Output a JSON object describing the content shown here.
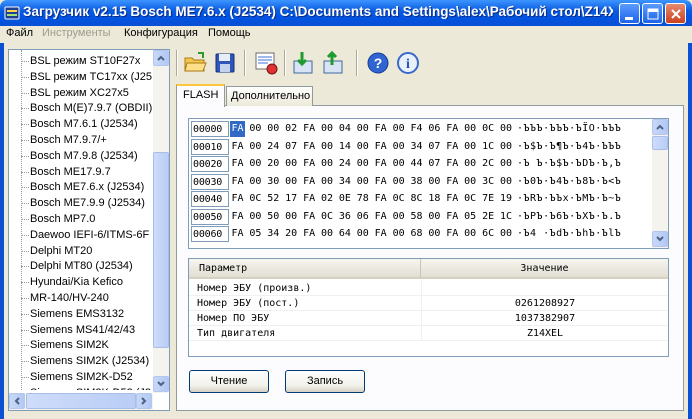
{
  "window": {
    "title": "Загрузчик v2.15 Bosch ME7.6.x (J2534) C:\\Documents and Settings\\alex\\Рабочий стол\\Z14X...",
    "controls": [
      "minimize",
      "maximize",
      "close"
    ]
  },
  "menu": {
    "file": "Файл",
    "tools": "Инструменты",
    "config": "Конфигурация",
    "help": "Помощь"
  },
  "ecu_list": [
    "BSL режим ST10F27x",
    "BSL режим TC17xx (J25",
    "BSL режим XC27x5",
    "Bosch M(E)7.9.7 (OBDII)",
    "Bosch M7.6.1 (J2534)",
    "Bosch M7.9.7/+",
    "Bosch M7.9.8 (J2534)",
    "Bosch ME17.9.7",
    "Bosch ME7.6.x (J2534)",
    "Bosch ME7.9.9 (J2534)",
    "Bosch MP7.0",
    "Daewoo IEFI-6/ITMS-6F",
    "Delphi MT20",
    "Delphi MT80 (J2534)",
    "Hyundai/Kia Kefico",
    "MR-140/HV-240",
    "Siemens EMS3132",
    "Siemens MS41/42/43",
    "Siemens SIM2K",
    "Siemens SIM2K (J2534)",
    "Siemens SIM2K-D52",
    "Siemens SIM2K-D52 (J2"
  ],
  "toolbar": {
    "icons": [
      "open-folder-icon",
      "save-disk-icon",
      "settings-sheet-icon",
      "tools-icon",
      "arrow-down-icon",
      "arrow-up-icon",
      "help-icon",
      "info-icon"
    ]
  },
  "tabs": [
    "FLASH",
    "Дополнительно"
  ],
  "hex": {
    "rows": [
      {
        "addr": "00000",
        "bytes": [
          "FA",
          "00",
          "00",
          "02",
          "FA",
          "00",
          "04",
          "00",
          "FA",
          "00",
          "F4",
          "06",
          "FA",
          "00",
          "0C",
          "00"
        ],
        "ascii": "·ЪЪЪ·ЪЪЪ·ЪЇО·ЪЪЪ"
      },
      {
        "addr": "00010",
        "bytes": [
          "FA",
          "00",
          "24",
          "07",
          "FA",
          "00",
          "14",
          "00",
          "FA",
          "00",
          "34",
          "07",
          "FA",
          "00",
          "1C",
          "00"
        ],
        "ascii": "·Ъ$Ъ·Ъ¶Ъ·Ъ4Ъ·ЪЪЪ"
      },
      {
        "addr": "00020",
        "bytes": [
          "FA",
          "00",
          "20",
          "00",
          "FA",
          "00",
          "24",
          "00",
          "FA",
          "00",
          "44",
          "07",
          "FA",
          "00",
          "2C",
          "00"
        ],
        "ascii": "·Ъ Ъ·Ъ$Ъ·ЪDЪ·Ъ,Ъ"
      },
      {
        "addr": "00030",
        "bytes": [
          "FA",
          "00",
          "30",
          "00",
          "FA",
          "00",
          "34",
          "00",
          "FA",
          "00",
          "38",
          "00",
          "FA",
          "00",
          "3C",
          "00"
        ],
        "ascii": "·Ъ0Ъ·Ъ4Ъ·Ъ8Ъ·Ъ<Ъ"
      },
      {
        "addr": "00040",
        "bytes": [
          "FA",
          "0C",
          "52",
          "17",
          "FA",
          "02",
          "0E",
          "78",
          "FA",
          "0C",
          "8C",
          "18",
          "FA",
          "0C",
          "7E",
          "19"
        ],
        "ascii": "·ЪRЪ·ЪЪx·ЪМЪ·Ъ~Ъ"
      },
      {
        "addr": "00050",
        "bytes": [
          "FA",
          "00",
          "50",
          "00",
          "FA",
          "0C",
          "36",
          "06",
          "FA",
          "00",
          "58",
          "00",
          "FA",
          "05",
          "2E",
          "1C"
        ],
        "ascii": "·ЪPЪ·Ъ6Ъ·ЪXЪ·Ъ.Ъ"
      },
      {
        "addr": "00060",
        "bytes": [
          "FA",
          "05",
          "34",
          "20",
          "FA",
          "00",
          "64",
          "00",
          "FA",
          "00",
          "68",
          "00",
          "FA",
          "00",
          "6C",
          "00"
        ],
        "ascii": "·Ъ4 ·ЪdЪ·ЪhЪ·ЪlЪ"
      }
    ],
    "selected": "FA"
  },
  "params": {
    "header_param": "Параметр",
    "header_value": "Значение",
    "rows": [
      {
        "name": "Номер ЭБУ (произв.)",
        "value": ""
      },
      {
        "name": "Номер ЭБУ (пост.)",
        "value": "0261208927"
      },
      {
        "name": "Номер ПО ЭБУ",
        "value": "1037382907"
      },
      {
        "name": "Тип двигателя",
        "value": "Z14XEL"
      }
    ]
  },
  "buttons": {
    "read": "Чтение",
    "write": "Запись"
  }
}
